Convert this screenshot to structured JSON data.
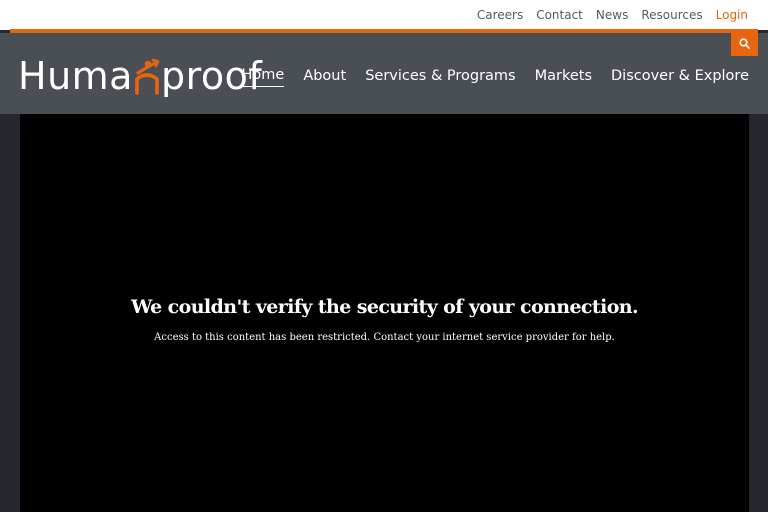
{
  "utility_nav": {
    "links": [
      "Careers",
      "Contact",
      "News",
      "Resources"
    ],
    "login_label": "Login"
  },
  "brand": {
    "name_left": "Huma",
    "name_right": "proof",
    "accent_color": "#e8650f"
  },
  "search": {
    "icon": "search-icon"
  },
  "main_nav": {
    "items": [
      "Home",
      "About",
      "Services & Programs",
      "Markets",
      "Discover & Explore"
    ],
    "active": "Home"
  },
  "error": {
    "heading": "We couldn't verify the security of your connection.",
    "detail": "Access to this content has been restricted. Contact your internet service provider for help."
  }
}
